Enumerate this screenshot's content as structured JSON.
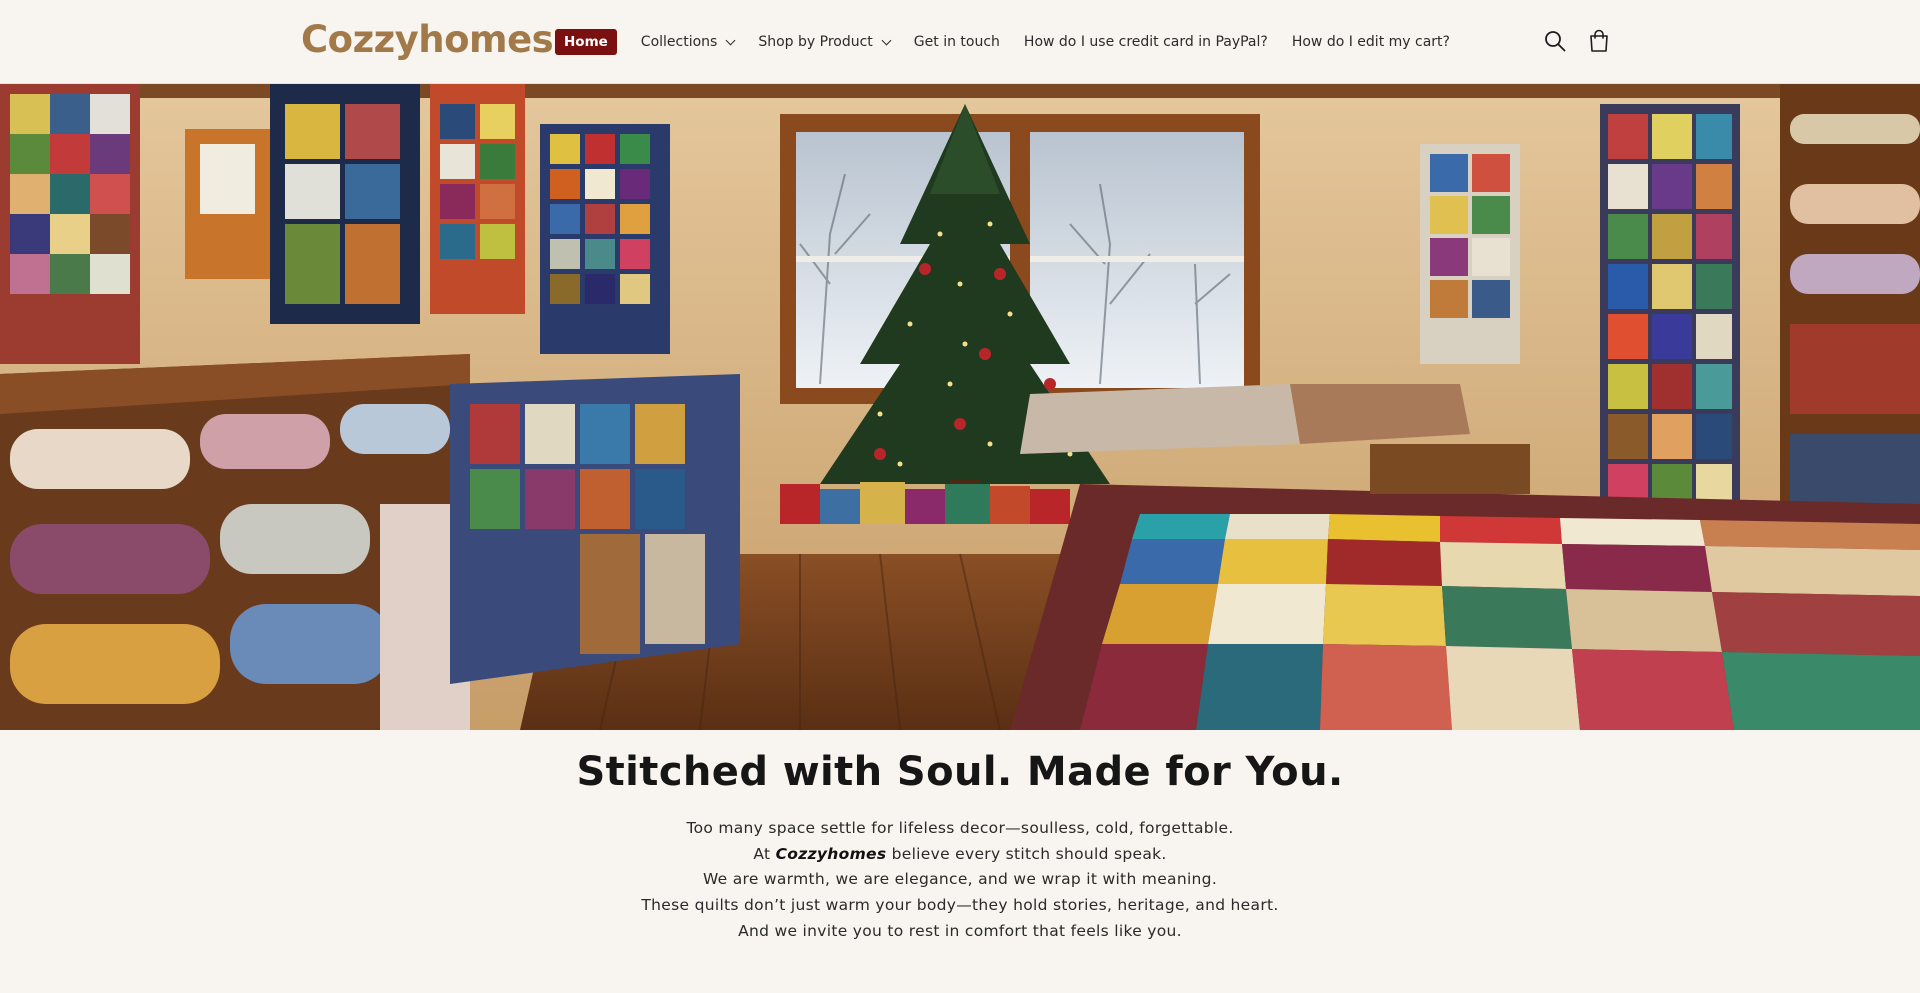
{
  "header": {
    "logo_text": "Cozzyhomes",
    "nav": [
      {
        "label": "Home",
        "active": true
      },
      {
        "label": "Collections",
        "dropdown": true
      },
      {
        "label": "Shop by Product",
        "dropdown": true
      },
      {
        "label": "Get in touch"
      },
      {
        "label": "How do I use credit card in PayPal?"
      },
      {
        "label": "How do I edit my cart?"
      }
    ],
    "icons": [
      "search-icon",
      "cart-icon"
    ]
  },
  "hero": {
    "image_subject": "quilt shop interior with Christmas tree"
  },
  "main": {
    "headline": "Stitched with Soul. Made for You.",
    "paragraph": {
      "line1": "Too many space settle for lifeless decor—soulless, cold, forgettable.",
      "line2_prefix": "At ",
      "line2_brand": "Cozzyhomes",
      "line2_suffix": " believe every stitch should speak.",
      "line3": "We are warmth, we are elegance, and we wrap it with meaning.",
      "line4": "These quilts don’t just warm your body—they hold stories, heritage, and heart.",
      "line5": "And we invite you to rest in comfort that feels like you."
    }
  },
  "colors": {
    "background": "#f8f5f0",
    "brand": "#a27a4a",
    "active_nav": "#7a1010",
    "text": "#1d1d1d"
  }
}
